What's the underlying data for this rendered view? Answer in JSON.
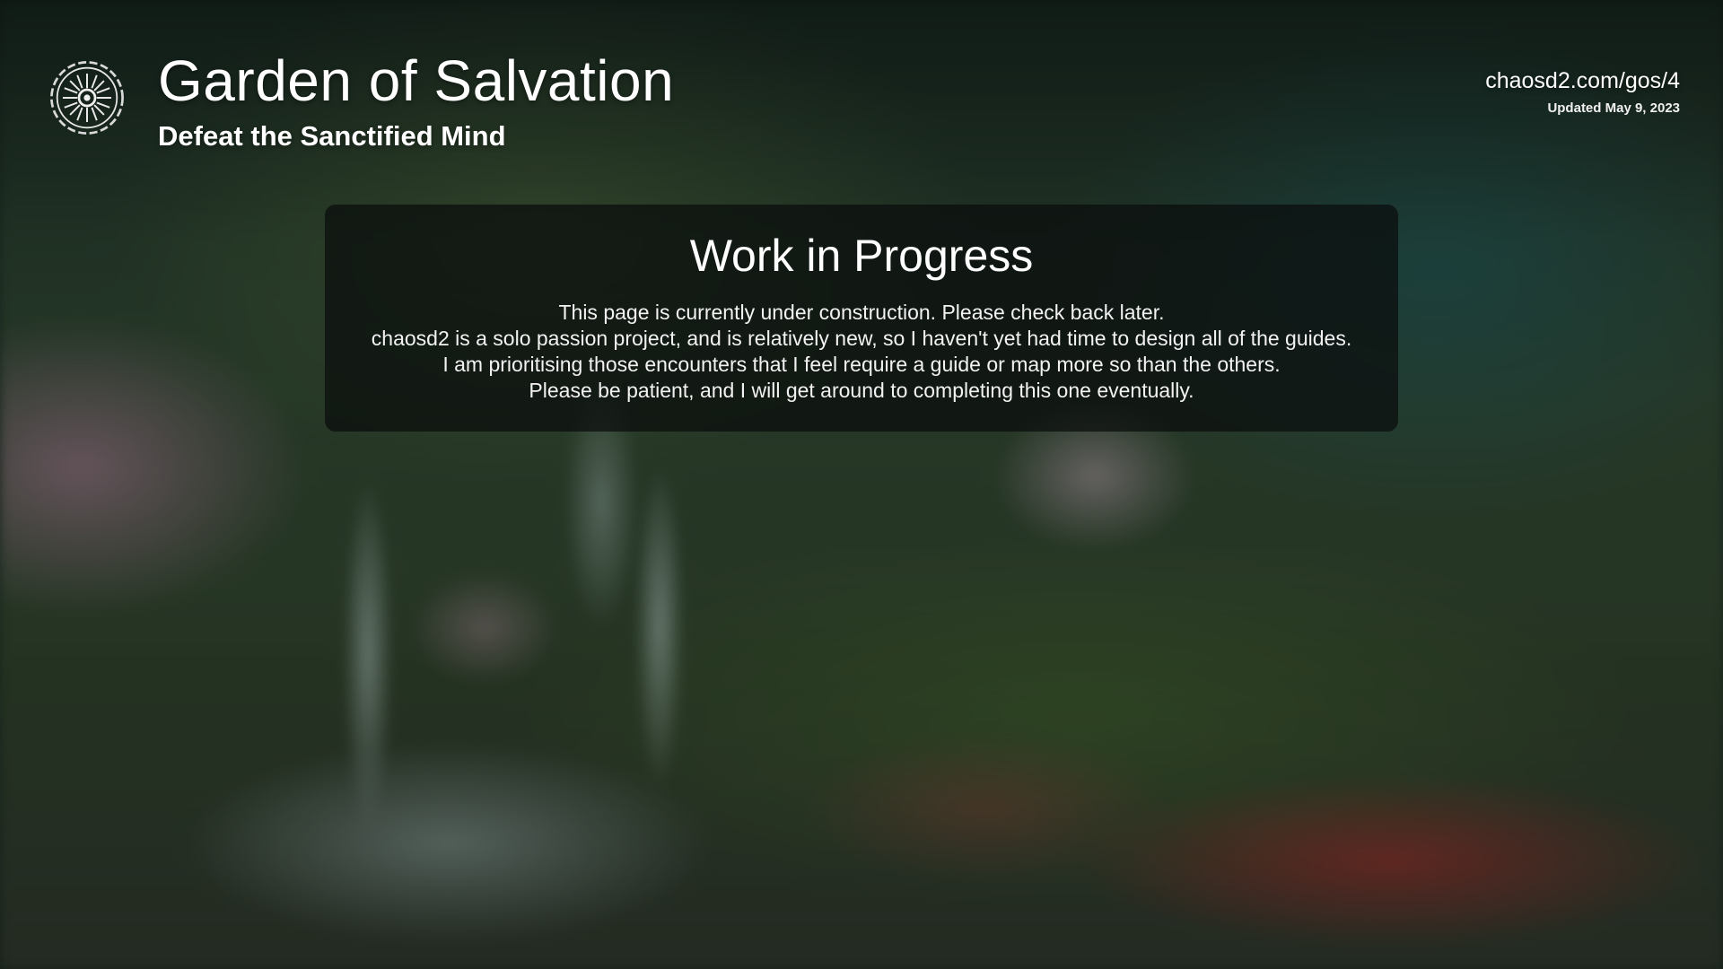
{
  "header": {
    "emblem_icon": "garden-of-salvation-emblem-icon",
    "title": "Garden of Salvation",
    "subtitle": "Defeat the Sanctified Mind",
    "url": "chaosd2.com/gos/4",
    "updated": "Updated May 9, 2023"
  },
  "notice": {
    "title": "Work in Progress",
    "lines": [
      "This page is currently under construction. Please check back later.",
      "chaosd2 is a solo passion project, and is relatively new, so I haven't yet had time to design all of the guides.",
      "I am prioritising those encounters that I feel require a guide or map more so than the others.",
      "Please be patient, and I will get around to completing this one eventually."
    ]
  },
  "colors": {
    "text": "#ffffff",
    "panel_background": "#0a0c0c",
    "background_tone": "#2b3f2c"
  }
}
